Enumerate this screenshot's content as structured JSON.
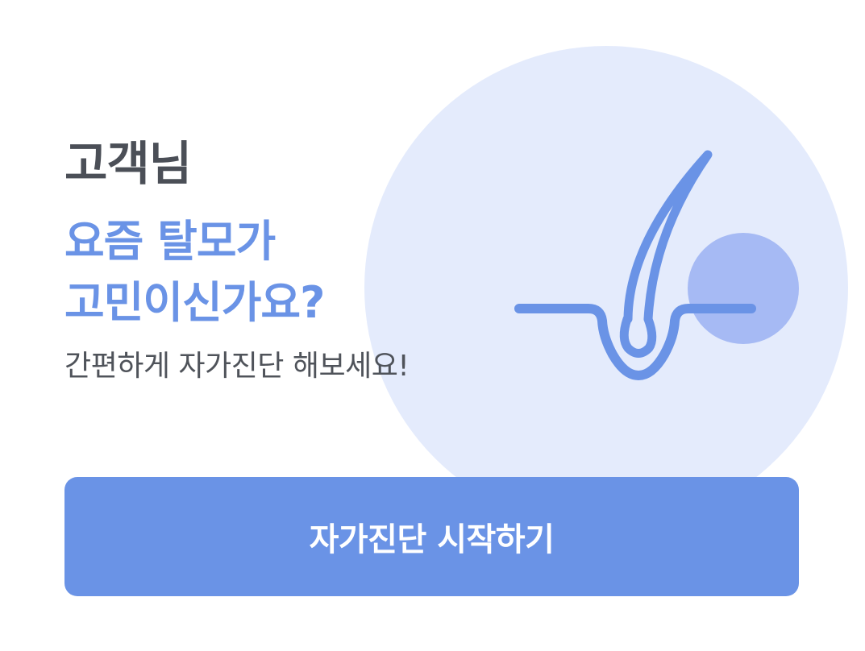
{
  "card": {
    "greeting": "고객님",
    "headline_line1": "요즘 탈모가",
    "headline_line2": "고민이신가요?",
    "subtext": "간편하게 자가진단 해보세요!",
    "start_button_label": "자가진단 시작하기"
  },
  "illustration": {
    "icon": "hair-follicle-icon"
  },
  "colors": {
    "accent": "#6a93e6",
    "circle_bg": "#e4ebfc",
    "dot": "#a6baf4",
    "heading_text": "#4b4f57",
    "body_text": "#4f535a",
    "button_text": "#ffffff"
  }
}
